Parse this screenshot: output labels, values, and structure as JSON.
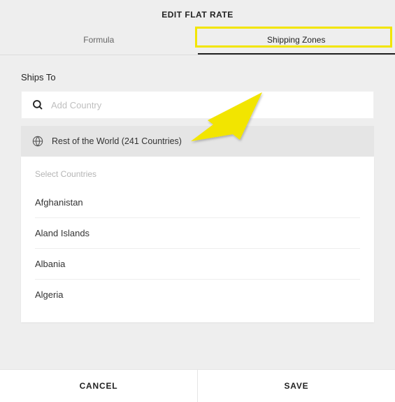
{
  "header": {
    "title": "EDIT FLAT RATE",
    "tabs": [
      "Formula",
      "Shipping Zones"
    ],
    "active_tab": 1
  },
  "section_label": "Ships To",
  "search": {
    "placeholder": "Add Country"
  },
  "rest_of_world": {
    "label": "Rest of the World (241 Countries)"
  },
  "select_label": "Select Countries",
  "countries": [
    "Afghanistan",
    "Aland Islands",
    "Albania",
    "Algeria"
  ],
  "footer": {
    "cancel": "CANCEL",
    "save": "SAVE"
  },
  "annotation": {
    "highlight_color": "#f2e500"
  }
}
